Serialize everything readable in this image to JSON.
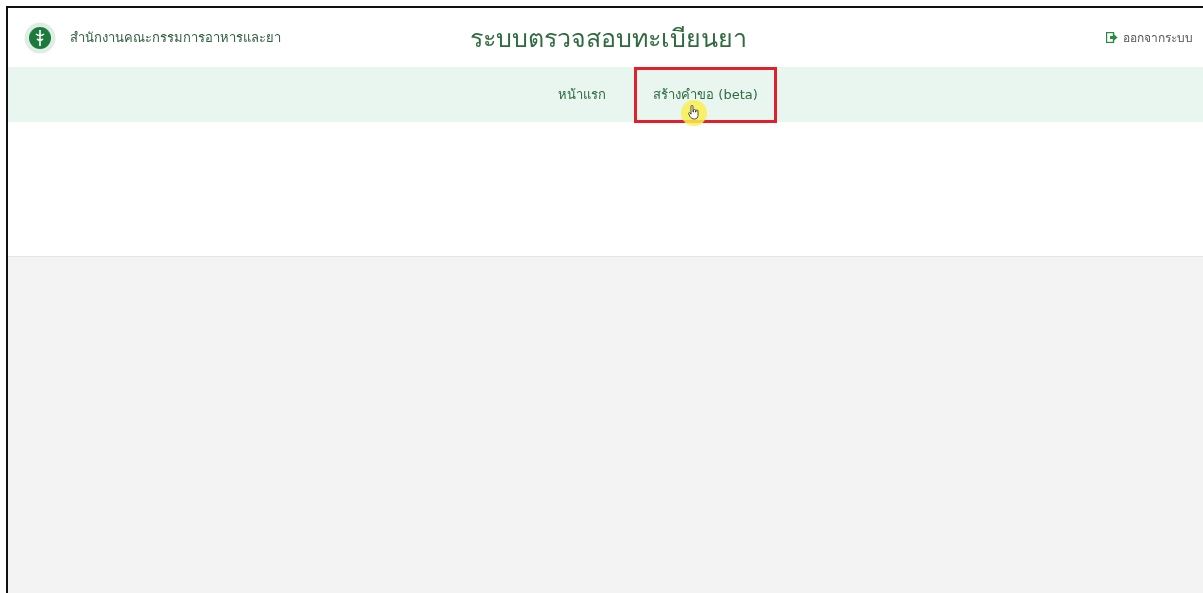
{
  "header": {
    "organization": "สำนักงานคณะกรรมการอาหารและยา",
    "title": "ระบบตรวจสอบทะเบียนยา",
    "logout": "ออกจากระบบ"
  },
  "nav": [
    {
      "label": "หน้าแรก",
      "highlighted": false
    },
    {
      "label": "สร้างคำขอ (beta)",
      "highlighted": true
    }
  ]
}
